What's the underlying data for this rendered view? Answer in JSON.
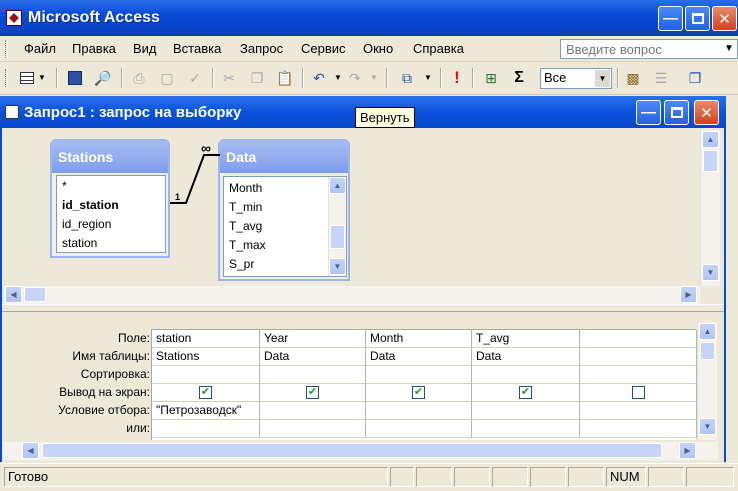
{
  "app": {
    "title": "Microsoft Access"
  },
  "menu": {
    "items": [
      "Файл",
      "Правка",
      "Вид",
      "Вставка",
      "Запрос",
      "Сервис",
      "Окно",
      "Справка"
    ],
    "ask_placeholder": "Введите вопрос"
  },
  "toolbar": {
    "all_select_value": "Все",
    "sigma_label": "Σ",
    "run_label": "!"
  },
  "query_window": {
    "title": "Запрос1 : запрос на выборку"
  },
  "tooltip": {
    "text": "Вернуть"
  },
  "tables": {
    "stations": {
      "name": "Stations",
      "fields": [
        "*",
        "id_station",
        "id_region",
        "station"
      ]
    },
    "data": {
      "name": "Data",
      "fields": [
        "Month",
        "T_min",
        "T_avg",
        "T_max",
        "S_pr"
      ]
    }
  },
  "relationship": {
    "one_label": "1",
    "many_label": "∞"
  },
  "grid": {
    "row_labels": [
      "Поле:",
      "Имя таблицы:",
      "Сортировка:",
      "Вывод на экран:",
      "Условие отбора:",
      "или:"
    ],
    "columns": [
      {
        "field": "station",
        "table": "Stations",
        "sort": "",
        "show": true,
        "criteria": "\"Петрозаводск\""
      },
      {
        "field": "Year",
        "table": "Data",
        "sort": "",
        "show": true,
        "criteria": ""
      },
      {
        "field": "Month",
        "table": "Data",
        "sort": "",
        "show": true,
        "criteria": ""
      },
      {
        "field": "T_avg",
        "table": "Data",
        "sort": "",
        "show": true,
        "criteria": ""
      },
      {
        "field": "",
        "table": "",
        "sort": "",
        "show": false,
        "criteria": ""
      }
    ]
  },
  "statusbar": {
    "text": "Готово",
    "num": "NUM"
  },
  "colors": {
    "titlebar": "#0a4ad7",
    "accent_check": "#21a121",
    "tooltip_bg": "#ffffe1"
  }
}
